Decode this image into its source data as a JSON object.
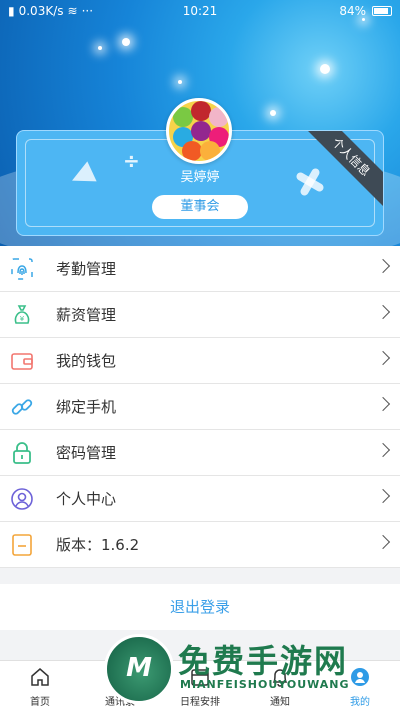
{
  "status_bar": {
    "speed": "0.03K/s",
    "time": "10:21",
    "battery": "84%"
  },
  "profile": {
    "name": "吴婷婷",
    "role": "董事会",
    "ribbon": "个人信息"
  },
  "menu": [
    {
      "label": "考勤管理",
      "icon": "fingerprint-icon",
      "color": "#3aa7e6"
    },
    {
      "label": "薪资管理",
      "icon": "money-bag-icon",
      "color": "#3bbf8a"
    },
    {
      "label": "我的钱包",
      "icon": "wallet-icon",
      "color": "#f2766f"
    },
    {
      "label": "绑定手机",
      "icon": "link-icon",
      "color": "#3aa7e6"
    },
    {
      "label": "密码管理",
      "icon": "lock-icon",
      "color": "#3bbf8a"
    },
    {
      "label": "个人中心",
      "icon": "user-icon",
      "color": "#6d62d8"
    },
    {
      "label": "版本：1.6.2",
      "icon": "bookmark-icon",
      "color": "#f3a53a"
    }
  ],
  "logout": "退出登录",
  "tabs": [
    {
      "label": "首页",
      "icon": "home-icon"
    },
    {
      "label": "通讯录",
      "icon": "contacts-icon"
    },
    {
      "label": "日程安排",
      "icon": "calendar-icon"
    },
    {
      "label": "通知",
      "icon": "bell-icon"
    },
    {
      "label": "我的",
      "icon": "profile-icon"
    }
  ],
  "watermark": {
    "title": "免费手游网",
    "subtitle": "MIANFEISHOUYOUWANG",
    "logo_letter": "M"
  },
  "colors": {
    "accent": "#2e9be6",
    "header": "#1684d8"
  }
}
